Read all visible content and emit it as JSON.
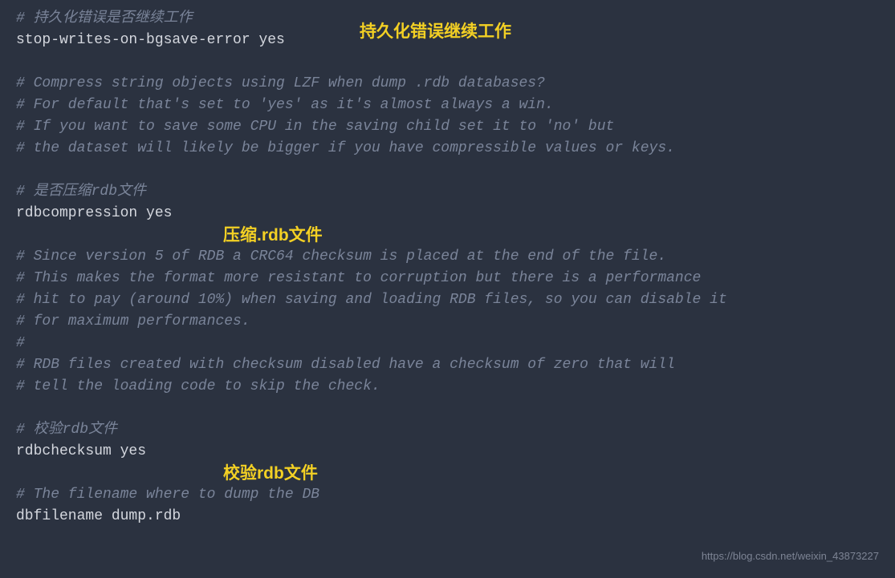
{
  "lines": {
    "c1": "# 持久化错误是否继续工作",
    "l1": "stop-writes-on-bgsave-error yes",
    "c2": "# Compress string objects using LZF when dump .rdb databases?",
    "c3": "# For default that's set to 'yes' as it's almost always a win.",
    "c4": "# If you want to save some CPU in the saving child set it to 'no' but",
    "c5": "# the dataset will likely be bigger if you have compressible values or keys.",
    "c6": "# 是否压缩rdb文件",
    "l2": "rdbcompression yes",
    "c7": "# Since version 5 of RDB a CRC64 checksum is placed at the end of the file.",
    "c8": "# This makes the format more resistant to corruption but there is a performance",
    "c9": "# hit to pay (around 10%) when saving and loading RDB files, so you can disable it",
    "c10": "# for maximum performances.",
    "c11": "#",
    "c12": "# RDB files created with checksum disabled have a checksum of zero that will",
    "c13": "# tell the loading code to skip the check.",
    "c14": "# 校验rdb文件",
    "l3": "rdbchecksum yes",
    "c15": "# The filename where to dump the DB",
    "l4": "dbfilename dump.rdb"
  },
  "annotations": {
    "a1": "持久化错误继续工作",
    "a2": "压缩.rdb文件",
    "a3": "校验rdb文件"
  },
  "watermark": "https://blog.csdn.net/weixin_43873227"
}
